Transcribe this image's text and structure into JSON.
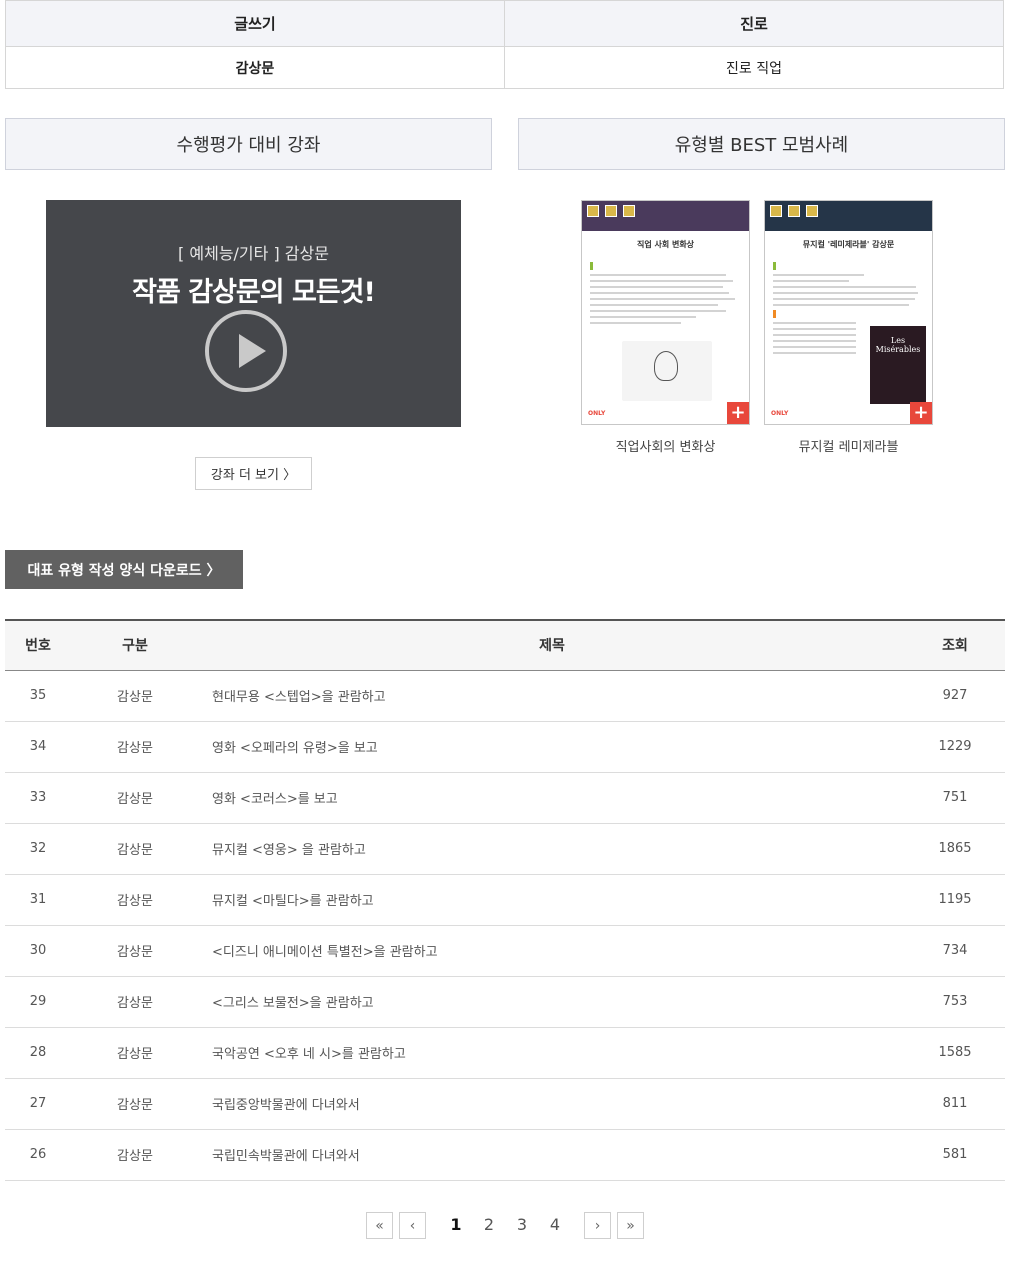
{
  "categories": {
    "headers": [
      "글쓰기",
      "진로"
    ],
    "values": [
      "감상문",
      "진로 직업"
    ]
  },
  "sections": {
    "lecture_title": "수행평가 대비 강좌",
    "best_title": "유형별 BEST 모범사례"
  },
  "video": {
    "category": "[ 예체능/기타 ] 감상문",
    "headline": "작품 감상문의 모든것!"
  },
  "more_button": "강좌 더 보기 〉",
  "best_cards": [
    {
      "doc_title": "직업 사회 변화상",
      "caption": "직업사회의 변화상"
    },
    {
      "doc_title": "뮤지컬 '레미제라블' 감상문",
      "caption": "뮤지컬 레미제라블"
    }
  ],
  "download_button": "대표 유형 작성 양식 다운로드 〉",
  "list": {
    "columns": [
      "번호",
      "구분",
      "제목",
      "조회"
    ],
    "rows": [
      {
        "no": "35",
        "cat": "감상문",
        "title": "현대무용 <스텝업>을 관람하고",
        "views": "927"
      },
      {
        "no": "34",
        "cat": "감상문",
        "title": "영화 <오페라의 유령>을 보고",
        "views": "1229"
      },
      {
        "no": "33",
        "cat": "감상문",
        "title": "영화 <코러스>를 보고",
        "views": "751"
      },
      {
        "no": "32",
        "cat": "감상문",
        "title": "뮤지컬 <영웅> 을 관람하고",
        "views": "1865"
      },
      {
        "no": "31",
        "cat": "감상문",
        "title": "뮤지컬 <마틸다>를 관람하고",
        "views": "1195"
      },
      {
        "no": "30",
        "cat": "감상문",
        "title": "<디즈니 애니메이션 특별전>을 관람하고",
        "views": "734"
      },
      {
        "no": "29",
        "cat": "감상문",
        "title": "<그리스 보물전>을 관람하고",
        "views": "753"
      },
      {
        "no": "28",
        "cat": "감상문",
        "title": "국악공연 <오후 네 시>를 관람하고",
        "views": "1585"
      },
      {
        "no": "27",
        "cat": "감상문",
        "title": "국립중앙박물관에 다녀와서",
        "views": "811"
      },
      {
        "no": "26",
        "cat": "감상문",
        "title": "국립민속박물관에 다녀와서",
        "views": "581"
      }
    ]
  },
  "pagination": {
    "first": "«",
    "prev": "‹",
    "pages": [
      "1",
      "2",
      "3",
      "4"
    ],
    "current": "1",
    "next": "›",
    "last": "»"
  }
}
